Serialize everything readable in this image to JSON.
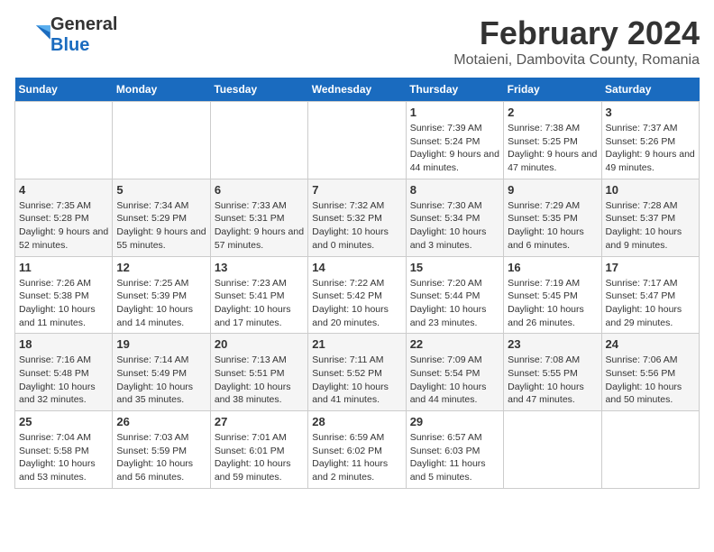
{
  "header": {
    "logo_general": "General",
    "logo_blue": "Blue",
    "month_year": "February 2024",
    "location": "Motaieni, Dambovita County, Romania"
  },
  "weekdays": [
    "Sunday",
    "Monday",
    "Tuesday",
    "Wednesday",
    "Thursday",
    "Friday",
    "Saturday"
  ],
  "weeks": [
    [
      {
        "day": "",
        "info": ""
      },
      {
        "day": "",
        "info": ""
      },
      {
        "day": "",
        "info": ""
      },
      {
        "day": "",
        "info": ""
      },
      {
        "day": "1",
        "sunrise": "Sunrise: 7:39 AM",
        "sunset": "Sunset: 5:24 PM",
        "daylight": "Daylight: 9 hours and 44 minutes."
      },
      {
        "day": "2",
        "sunrise": "Sunrise: 7:38 AM",
        "sunset": "Sunset: 5:25 PM",
        "daylight": "Daylight: 9 hours and 47 minutes."
      },
      {
        "day": "3",
        "sunrise": "Sunrise: 7:37 AM",
        "sunset": "Sunset: 5:26 PM",
        "daylight": "Daylight: 9 hours and 49 minutes."
      }
    ],
    [
      {
        "day": "4",
        "sunrise": "Sunrise: 7:35 AM",
        "sunset": "Sunset: 5:28 PM",
        "daylight": "Daylight: 9 hours and 52 minutes."
      },
      {
        "day": "5",
        "sunrise": "Sunrise: 7:34 AM",
        "sunset": "Sunset: 5:29 PM",
        "daylight": "Daylight: 9 hours and 55 minutes."
      },
      {
        "day": "6",
        "sunrise": "Sunrise: 7:33 AM",
        "sunset": "Sunset: 5:31 PM",
        "daylight": "Daylight: 9 hours and 57 minutes."
      },
      {
        "day": "7",
        "sunrise": "Sunrise: 7:32 AM",
        "sunset": "Sunset: 5:32 PM",
        "daylight": "Daylight: 10 hours and 0 minutes."
      },
      {
        "day": "8",
        "sunrise": "Sunrise: 7:30 AM",
        "sunset": "Sunset: 5:34 PM",
        "daylight": "Daylight: 10 hours and 3 minutes."
      },
      {
        "day": "9",
        "sunrise": "Sunrise: 7:29 AM",
        "sunset": "Sunset: 5:35 PM",
        "daylight": "Daylight: 10 hours and 6 minutes."
      },
      {
        "day": "10",
        "sunrise": "Sunrise: 7:28 AM",
        "sunset": "Sunset: 5:37 PM",
        "daylight": "Daylight: 10 hours and 9 minutes."
      }
    ],
    [
      {
        "day": "11",
        "sunrise": "Sunrise: 7:26 AM",
        "sunset": "Sunset: 5:38 PM",
        "daylight": "Daylight: 10 hours and 11 minutes."
      },
      {
        "day": "12",
        "sunrise": "Sunrise: 7:25 AM",
        "sunset": "Sunset: 5:39 PM",
        "daylight": "Daylight: 10 hours and 14 minutes."
      },
      {
        "day": "13",
        "sunrise": "Sunrise: 7:23 AM",
        "sunset": "Sunset: 5:41 PM",
        "daylight": "Daylight: 10 hours and 17 minutes."
      },
      {
        "day": "14",
        "sunrise": "Sunrise: 7:22 AM",
        "sunset": "Sunset: 5:42 PM",
        "daylight": "Daylight: 10 hours and 20 minutes."
      },
      {
        "day": "15",
        "sunrise": "Sunrise: 7:20 AM",
        "sunset": "Sunset: 5:44 PM",
        "daylight": "Daylight: 10 hours and 23 minutes."
      },
      {
        "day": "16",
        "sunrise": "Sunrise: 7:19 AM",
        "sunset": "Sunset: 5:45 PM",
        "daylight": "Daylight: 10 hours and 26 minutes."
      },
      {
        "day": "17",
        "sunrise": "Sunrise: 7:17 AM",
        "sunset": "Sunset: 5:47 PM",
        "daylight": "Daylight: 10 hours and 29 minutes."
      }
    ],
    [
      {
        "day": "18",
        "sunrise": "Sunrise: 7:16 AM",
        "sunset": "Sunset: 5:48 PM",
        "daylight": "Daylight: 10 hours and 32 minutes."
      },
      {
        "day": "19",
        "sunrise": "Sunrise: 7:14 AM",
        "sunset": "Sunset: 5:49 PM",
        "daylight": "Daylight: 10 hours and 35 minutes."
      },
      {
        "day": "20",
        "sunrise": "Sunrise: 7:13 AM",
        "sunset": "Sunset: 5:51 PM",
        "daylight": "Daylight: 10 hours and 38 minutes."
      },
      {
        "day": "21",
        "sunrise": "Sunrise: 7:11 AM",
        "sunset": "Sunset: 5:52 PM",
        "daylight": "Daylight: 10 hours and 41 minutes."
      },
      {
        "day": "22",
        "sunrise": "Sunrise: 7:09 AM",
        "sunset": "Sunset: 5:54 PM",
        "daylight": "Daylight: 10 hours and 44 minutes."
      },
      {
        "day": "23",
        "sunrise": "Sunrise: 7:08 AM",
        "sunset": "Sunset: 5:55 PM",
        "daylight": "Daylight: 10 hours and 47 minutes."
      },
      {
        "day": "24",
        "sunrise": "Sunrise: 7:06 AM",
        "sunset": "Sunset: 5:56 PM",
        "daylight": "Daylight: 10 hours and 50 minutes."
      }
    ],
    [
      {
        "day": "25",
        "sunrise": "Sunrise: 7:04 AM",
        "sunset": "Sunset: 5:58 PM",
        "daylight": "Daylight: 10 hours and 53 minutes."
      },
      {
        "day": "26",
        "sunrise": "Sunrise: 7:03 AM",
        "sunset": "Sunset: 5:59 PM",
        "daylight": "Daylight: 10 hours and 56 minutes."
      },
      {
        "day": "27",
        "sunrise": "Sunrise: 7:01 AM",
        "sunset": "Sunset: 6:01 PM",
        "daylight": "Daylight: 10 hours and 59 minutes."
      },
      {
        "day": "28",
        "sunrise": "Sunrise: 6:59 AM",
        "sunset": "Sunset: 6:02 PM",
        "daylight": "Daylight: 11 hours and 2 minutes."
      },
      {
        "day": "29",
        "sunrise": "Sunrise: 6:57 AM",
        "sunset": "Sunset: 6:03 PM",
        "daylight": "Daylight: 11 hours and 5 minutes."
      },
      {
        "day": "",
        "info": ""
      },
      {
        "day": "",
        "info": ""
      }
    ]
  ]
}
